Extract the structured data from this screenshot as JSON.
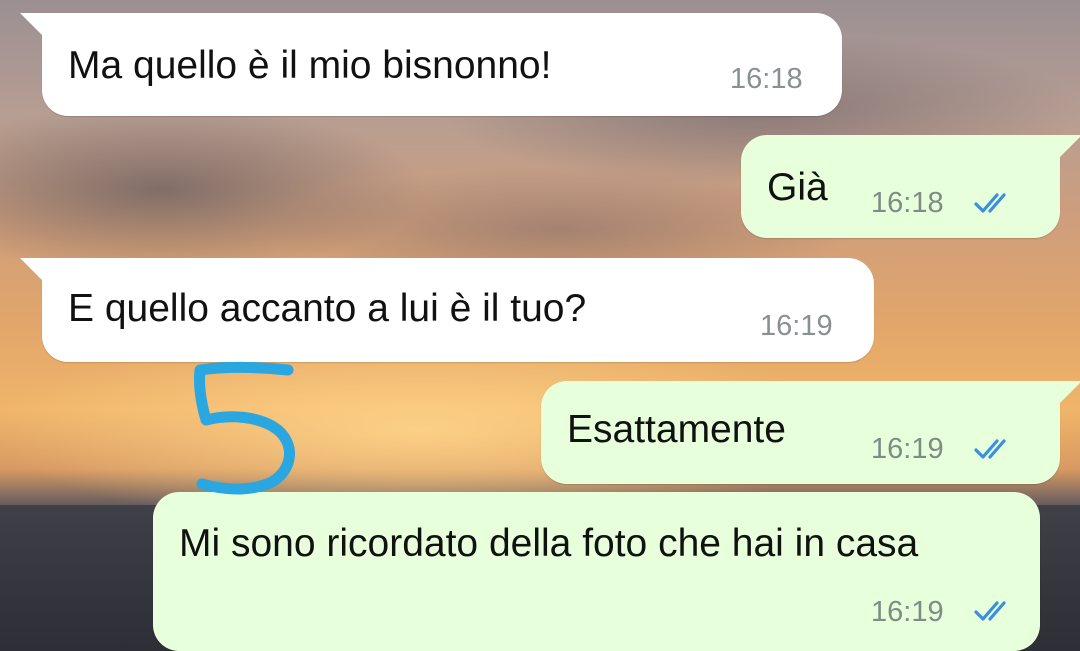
{
  "messages": [
    {
      "direction": "incoming",
      "text": "Ma quello è il mio bisnonno!",
      "time": "16:18"
    },
    {
      "direction": "outgoing",
      "text": "Già",
      "time": "16:18",
      "status_icon": "double-check-read-icon"
    },
    {
      "direction": "incoming",
      "text": "E quello accanto a lui è il tuo?",
      "time": "16:19"
    },
    {
      "direction": "outgoing",
      "text": "Esattamente",
      "time": "16:19",
      "status_icon": "double-check-read-icon"
    },
    {
      "direction": "outgoing",
      "text": "Mi sono ricordato della foto che hai in casa",
      "time": "16:19",
      "status_icon": "double-check-read-icon"
    }
  ],
  "annotation": {
    "text": "5",
    "color": "#2aa7e0"
  },
  "colors": {
    "incoming_bubble": "#ffffff",
    "outgoing_bubble": "#e7ffdb",
    "read_check": "#3a8fe0",
    "timestamp": "#8a8f91"
  }
}
